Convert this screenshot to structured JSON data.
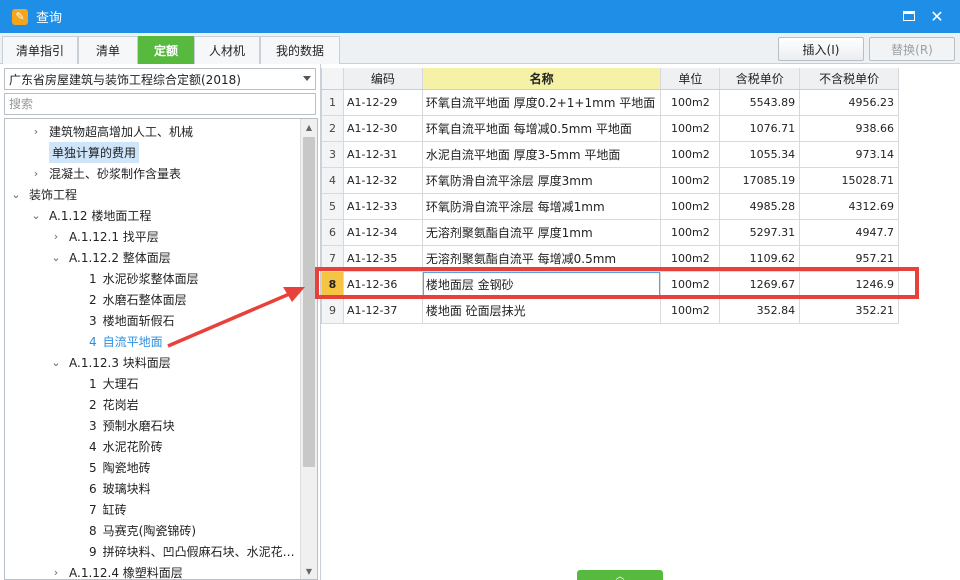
{
  "window": {
    "title": "查询",
    "icon": "notepad-edit-icon"
  },
  "tabs": [
    {
      "label": "清单指引"
    },
    {
      "label": "清单"
    },
    {
      "label": "定额",
      "active": true
    },
    {
      "label": "人材机"
    },
    {
      "label": "我的数据"
    }
  ],
  "toolbar": {
    "insert_label": "插入(I)",
    "replace_label": "替换(R)"
  },
  "left": {
    "quota_library": "广东省房屋建筑与装饰工程综合定额(2018)",
    "search_placeholder": "搜索",
    "tree": [
      {
        "label": "建筑物超高增加人工、机械",
        "chevron": "right"
      },
      {
        "label": "单独计算的费用",
        "selected": true
      },
      {
        "label": "混凝土、砂浆制作含量表",
        "chevron": "right"
      },
      {
        "label": "装饰工程",
        "chevron": "down"
      },
      {
        "label": "A.1.12 楼地面工程",
        "chevron": "down"
      },
      {
        "label": "A.1.12.1 找平层",
        "chevron": "right"
      },
      {
        "label": "A.1.12.2 整体面层",
        "chevron": "down"
      },
      {
        "num": "1",
        "label": "水泥砂浆整体面层"
      },
      {
        "num": "2",
        "label": "水磨石整体面层"
      },
      {
        "num": "3",
        "label": "楼地面斩假石"
      },
      {
        "num": "4",
        "label": "自流平地面",
        "current": true
      },
      {
        "label": "A.1.12.3 块料面层",
        "chevron": "down"
      },
      {
        "num": "1",
        "label": "大理石"
      },
      {
        "num": "2",
        "label": "花岗岩"
      },
      {
        "num": "3",
        "label": "预制水磨石块"
      },
      {
        "num": "4",
        "label": "水泥花阶砖"
      },
      {
        "num": "5",
        "label": "陶瓷地砖"
      },
      {
        "num": "6",
        "label": "玻璃块料"
      },
      {
        "num": "7",
        "label": "缸砖"
      },
      {
        "num": "8",
        "label": "马赛克(陶瓷锦砖)"
      },
      {
        "num": "9",
        "label": "拼碎块料、凹凸假麻石块、水泥花…"
      },
      {
        "label": "A.1.12.4 橡塑料面层",
        "chevron": "right"
      }
    ]
  },
  "grid": {
    "columns": [
      "",
      "编码",
      "名称",
      "单位",
      "含税单价",
      "不含税单价"
    ],
    "rows": [
      {
        "idx": "1",
        "code": "A1-12-29",
        "name": "环氧自流平地面 厚度0.2+1+1mm 平地面",
        "unit": "100m2",
        "tax": "5543.89",
        "notax": "4956.23"
      },
      {
        "idx": "2",
        "code": "A1-12-30",
        "name": "环氧自流平地面 每增减0.5mm 平地面",
        "unit": "100m2",
        "tax": "1076.71",
        "notax": "938.66"
      },
      {
        "idx": "3",
        "code": "A1-12-31",
        "name": "水泥自流平地面 厚度3-5mm 平地面",
        "unit": "100m2",
        "tax": "1055.34",
        "notax": "973.14"
      },
      {
        "idx": "4",
        "code": "A1-12-32",
        "name": "环氧防滑自流平涂层 厚度3mm",
        "unit": "100m2",
        "tax": "17085.19",
        "notax": "15028.71"
      },
      {
        "idx": "5",
        "code": "A1-12-33",
        "name": "环氧防滑自流平涂层 每增减1mm",
        "unit": "100m2",
        "tax": "4985.28",
        "notax": "4312.69"
      },
      {
        "idx": "6",
        "code": "A1-12-34",
        "name": "无溶剂聚氨酯自流平 厚度1mm",
        "unit": "100m2",
        "tax": "5297.31",
        "notax": "4947.7"
      },
      {
        "idx": "7",
        "code": "A1-12-35",
        "name": "无溶剂聚氨酯自流平 每增减0.5mm",
        "unit": "100m2",
        "tax": "1109.62",
        "notax": "957.21"
      },
      {
        "idx": "8",
        "code": "A1-12-36",
        "name": "楼地面层 金钢砂",
        "unit": "100m2",
        "tax": "1269.67",
        "notax": "1246.9",
        "selected": true
      },
      {
        "idx": "9",
        "code": "A1-12-37",
        "name": "楼地面 砼面层抹光",
        "unit": "100m2",
        "tax": "352.84",
        "notax": "352.21"
      }
    ]
  },
  "colors": {
    "titlebar": "#1f8ee6",
    "active_tab": "#57b93e",
    "annotation": "#e8413b",
    "row_marker": "#f6c445"
  }
}
